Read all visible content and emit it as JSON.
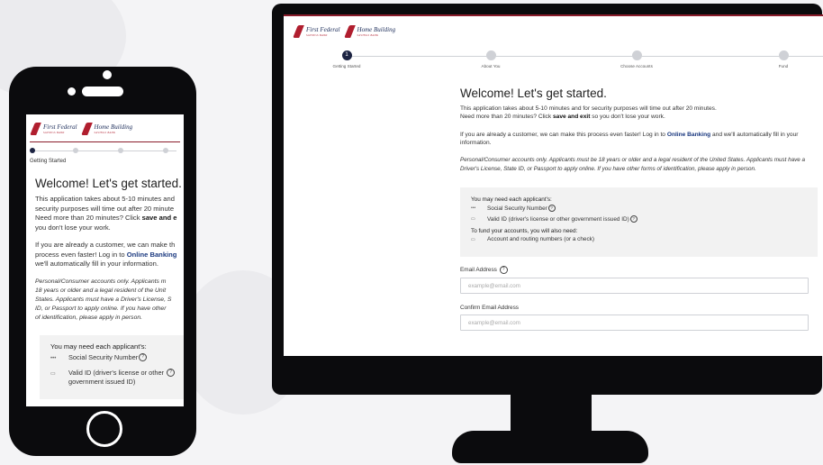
{
  "brand": {
    "logo1": "First Federal",
    "logo1_sub": "SAVINGS BANK",
    "logo2": "Home Building",
    "logo2_sub": "SAVINGS BANK",
    "accent": "#8a1c2b",
    "navy": "#1c2342"
  },
  "steps": [
    {
      "number": "1",
      "label": "Getting Started"
    },
    {
      "number": "",
      "label": "About You"
    },
    {
      "number": "",
      "label": "Choose Accounts"
    },
    {
      "number": "",
      "label": "Fund"
    }
  ],
  "welcome": {
    "title": "Welcome! Let's get started.",
    "line1": "This application takes about 5-10 minutes and for security purposes will time out after 20 minutes.",
    "line2_pre": "Need more than 20 minutes? Click ",
    "line2_bold": "save and exit",
    "line2_post": " so you don't lose your work.",
    "customer_pre": "If you are already a customer, we can make this process even faster! Log in to ",
    "customer_link": "Online Banking",
    "customer_post": " and we'll automatically fill in your information.",
    "disclaimer": "Personal/Consumer accounts only. Applicants must be 18 years or older and a legal resident of the United States. Applicants must have a Driver's License, State ID, or Passport to apply online. If you have other forms of identification, please apply in person."
  },
  "mobile": {
    "m1": "This application takes about 5-10 minutes and",
    "m2": "security purposes will time out after 20 minute",
    "m3_pre": "Need more than 20 minutes? Click ",
    "m3_bold": "save and e",
    "m4": "you don't lose your work.",
    "c1": "If you are already a customer, we can make th",
    "c2_pre": "process even faster! Log in to ",
    "c2_link": "Online Banking",
    "c3": "we'll automatically fill in your information.",
    "d1": "Personal/Consumer accounts only. Applicants m",
    "d2": "18 years or older and a legal resident of the Unit",
    "d3": "States. Applicants must have a Driver's License, S",
    "d4": "ID, or Passport to apply online. If you have other",
    "d5": "of identification, please apply in person.",
    "valid_id_line1": "Valid ID (driver's license or other",
    "valid_id_line2": "government issued ID)"
  },
  "requirements": {
    "title": "You may need each applicant's:",
    "ssn": "Social Security Number",
    "valid_id": "Valid ID (driver's license or other government issued ID)",
    "fund_title": "To fund your accounts, you will also need:",
    "routing": "Account and routing numbers (or a check)"
  },
  "icons": {
    "ssn": "•••",
    "id": "▭",
    "bank": "▭",
    "help": "?"
  },
  "form": {
    "email_label": "Email Address",
    "email_placeholder": "example@email.com",
    "confirm_label": "Confirm Email Address",
    "confirm_placeholder": "example@email.com"
  }
}
